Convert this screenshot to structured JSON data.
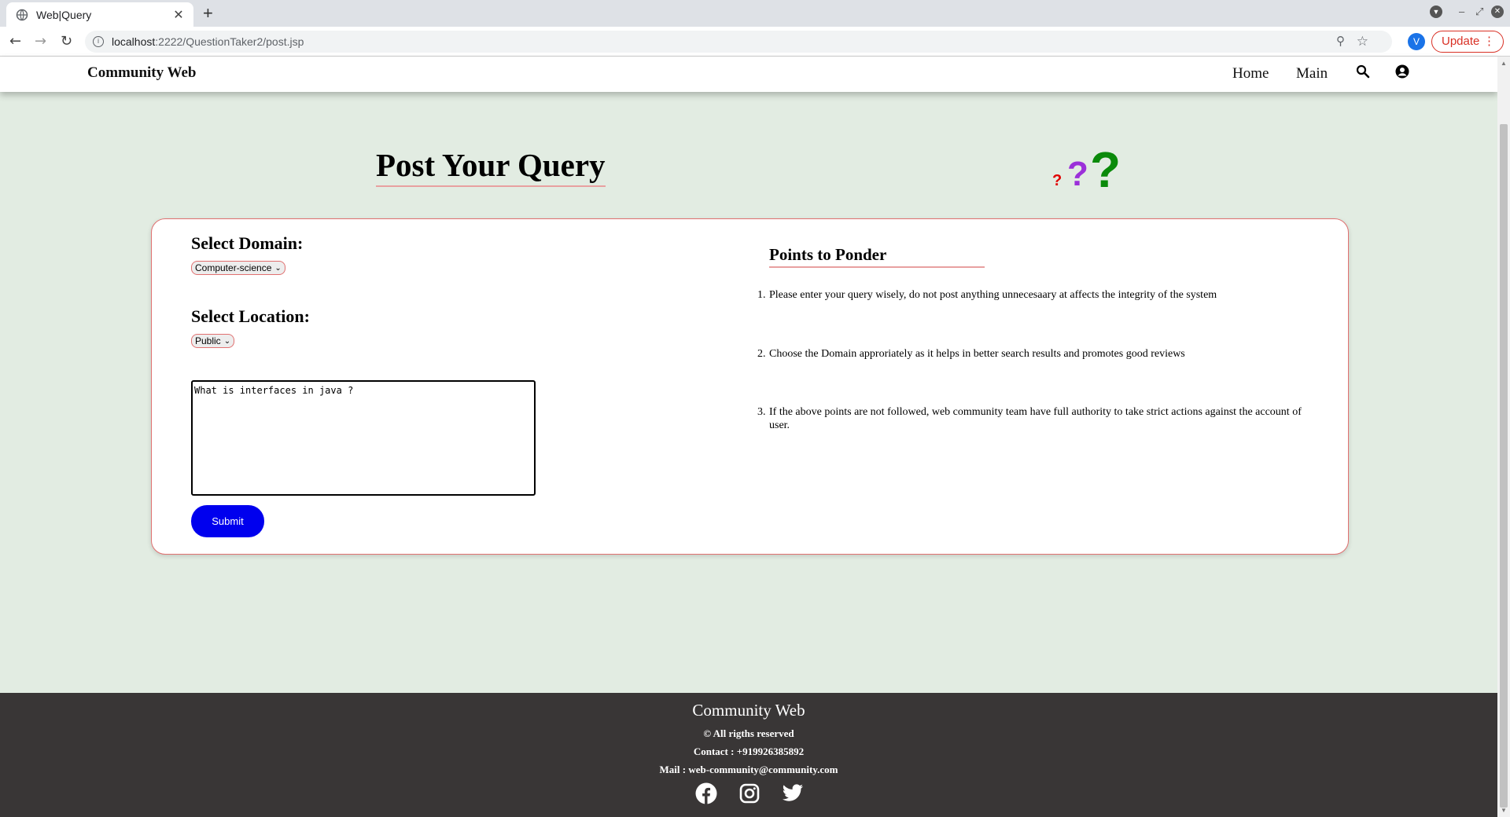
{
  "browser": {
    "tab_title": "Web|Query",
    "tab_close": "✕",
    "new_tab": "+",
    "url_host": "localhost",
    "url_rest": ":2222/QuestionTaker2/post.jsp",
    "profile_initial": "V",
    "update_label": "Update"
  },
  "nav": {
    "brand": "Community Web",
    "links": [
      "Home",
      "Main"
    ],
    "icons": [
      "search-icon",
      "user-circle-icon"
    ]
  },
  "page": {
    "title": "Post Your Query"
  },
  "form": {
    "domain_label": "Select Domain:",
    "domain_value": "Computer-science",
    "location_label": "Select Location:",
    "location_value": "Public",
    "query_text": "What is interfaces in java ?",
    "submit_label": "Submit"
  },
  "ponder": {
    "title": "Points to Ponder",
    "items": [
      {
        "num": "1.",
        "text": "Please enter your query wisely, do not post anything unnecesaary at affects the integrity of the system"
      },
      {
        "num": "2.",
        "text": "Choose the Domain approriately as it helps in better search results and promotes good reviews"
      },
      {
        "num": "3.",
        "text": "If the above points are not followed, web community team have full authority to take strict actions against the account of user."
      }
    ]
  },
  "footer": {
    "brand": "Community Web",
    "rights": "© All rigths reserved",
    "contact": "Contact : +919926385892",
    "mail": "Mail : web-community@community.com",
    "social_icons": [
      "facebook-icon",
      "instagram-icon",
      "twitter-icon"
    ]
  },
  "colors": {
    "page_bg": "#e2ece2",
    "submit_bg": "#0000ee",
    "card_border": "#e07070",
    "footer_bg": "#393636",
    "qmark_red": "#e00000",
    "qmark_purple": "#9b30d9",
    "qmark_green": "#0a8a0a"
  }
}
